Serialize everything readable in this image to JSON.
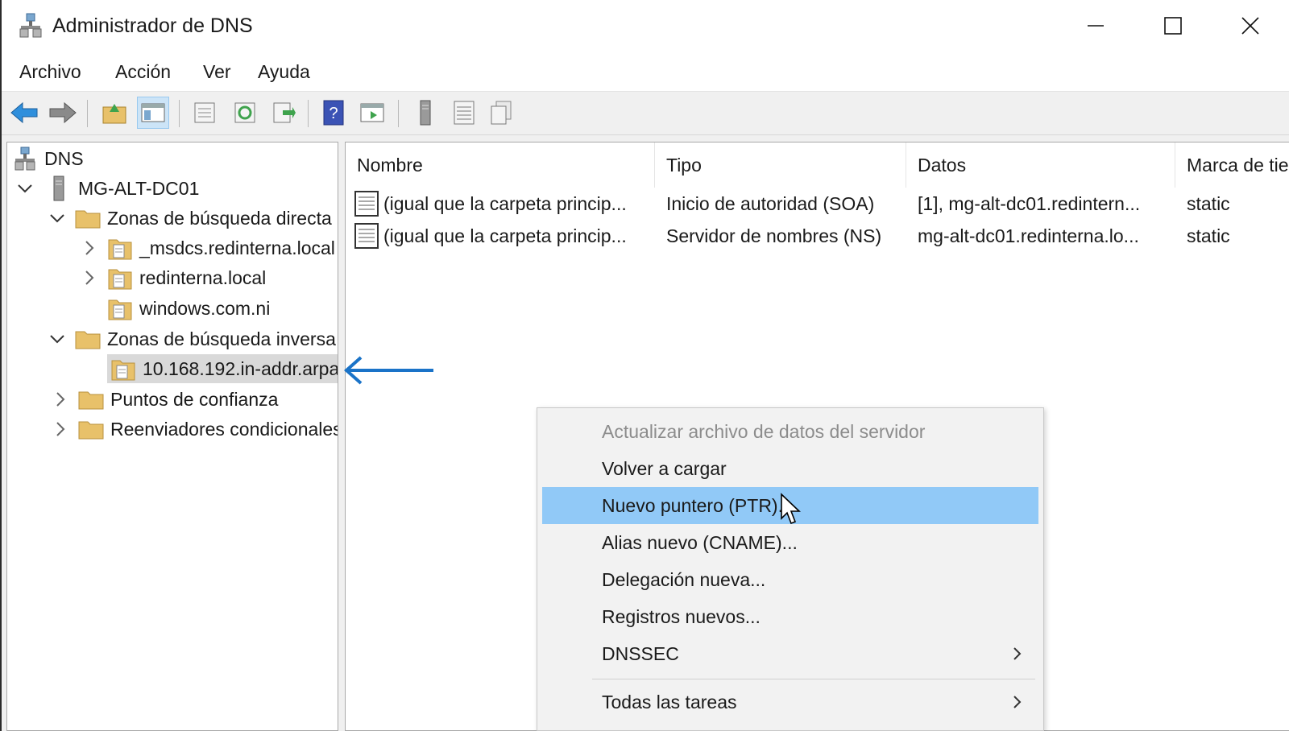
{
  "window": {
    "title": "Administrador de DNS",
    "controls": [
      "minimize",
      "maximize",
      "close"
    ]
  },
  "menubar": {
    "items": [
      "Archivo",
      "Acción",
      "Ver",
      "Ayuda"
    ]
  },
  "toolbar": {
    "icons": [
      "back-arrow-icon",
      "forward-arrow-icon",
      "up-folder-icon",
      "show-hide-tree-icon",
      "properties-icon",
      "refresh-icon",
      "export-list-icon",
      "help-icon",
      "action-pane-icon",
      "server-icon",
      "list-icon",
      "copy-icon"
    ]
  },
  "tree": {
    "items": [
      {
        "label": "DNS"
      },
      {
        "label": "MG-ALT-DC01"
      },
      {
        "label": "Zonas de búsqueda directa"
      },
      {
        "label": "_msdcs.redinterna.local"
      },
      {
        "label": "redinterna.local"
      },
      {
        "label": "windows.com.ni"
      },
      {
        "label": "Zonas de búsqueda inversa"
      },
      {
        "label": "10.168.192.in-addr.arpa"
      },
      {
        "label": "Puntos de confianza"
      },
      {
        "label": "Reenviadores condicionales"
      }
    ],
    "selected": "10.168.192.in-addr.arpa"
  },
  "list": {
    "columns": [
      "Nombre",
      "Tipo",
      "Datos",
      "Marca de tiempo"
    ],
    "rows": [
      {
        "nombre": "(igual que la carpeta princip...",
        "tipo": "Inicio de autoridad (SOA)",
        "datos": "[1], mg-alt-dc01.redintern...",
        "marca": "static"
      },
      {
        "nombre": "(igual que la carpeta princip...",
        "tipo": "Servidor de nombres (NS)",
        "datos": "mg-alt-dc01.redinterna.lo...",
        "marca": "static"
      }
    ]
  },
  "context_menu": {
    "items": [
      {
        "label": "Actualizar archivo de datos del servidor",
        "state": "disabled"
      },
      {
        "label": "Volver a cargar",
        "state": "normal"
      },
      {
        "label": "Nuevo puntero (PTR)...",
        "state": "hover"
      },
      {
        "label": "Alias nuevo (CNAME)...",
        "state": "normal"
      },
      {
        "label": "Delegación nueva...",
        "state": "normal"
      },
      {
        "label": "Registros nuevos...",
        "state": "normal"
      },
      {
        "label": "DNSSEC",
        "state": "submenu"
      },
      {
        "label": "Todas las tareas",
        "state": "submenu"
      }
    ]
  },
  "colors": {
    "menu_hover": "#91c9f7",
    "annotation_arrow": "#1a73c8",
    "folder": "#e8c16a"
  }
}
